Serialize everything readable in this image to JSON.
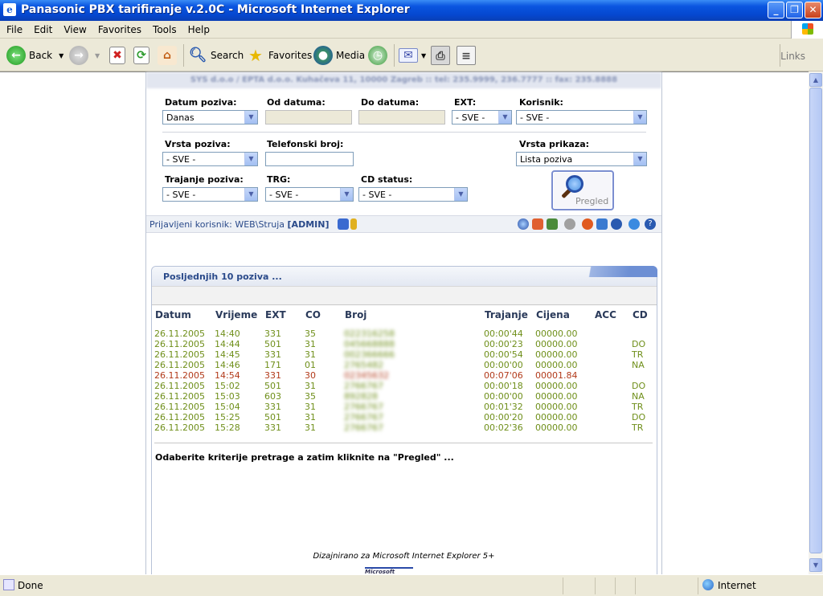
{
  "window": {
    "title": "Panasonic PBX tarifiranje v.2.0C - Microsoft Internet Explorer"
  },
  "menu": [
    "File",
    "Edit",
    "View",
    "Favorites",
    "Tools",
    "Help"
  ],
  "toolbar": {
    "back": "Back",
    "search": "Search",
    "favorites": "Favorites",
    "media": "Media",
    "links": "Links"
  },
  "page": {
    "company": "SYS d.o.o / EPTA d.o.o. Kuhačeva 11, 10000 Zagreb :: tel: 235.9999, 236.7777 :: fax: 235.8888",
    "filters": {
      "datum_poziva_label": "Datum poziva:",
      "datum_poziva_value": "Danas",
      "od_datuma_label": "Od datuma:",
      "do_datuma_label": "Do datuma:",
      "ext_label": "EXT:",
      "ext_value": "- SVE -",
      "korisnik_label": "Korisnik:",
      "korisnik_value": "- SVE -",
      "vrsta_poziva_label": "Vrsta poziva:",
      "vrsta_poziva_value": "- SVE -",
      "telefonski_broj_label": "Telefonski broj:",
      "vrsta_prikaza_label": "Vrsta prikaza:",
      "vrsta_prikaza_value": "Lista poziva",
      "trajanje_poziva_label": "Trajanje poziva:",
      "trajanje_poziva_value": "- SVE -",
      "trg_label": "TRG:",
      "trg_value": "- SVE -",
      "cd_status_label": "CD status:",
      "cd_status_value": "- SVE -",
      "pregled": "Pregled"
    },
    "status": {
      "prefix": "Prijavljeni korisnik: ",
      "user": "WEB\\Struja",
      "role": "[ADMIN]"
    },
    "panel_title": "Posljednjih 10 poziva ...",
    "columns": [
      "Datum",
      "Vrijeme",
      "EXT",
      "CO",
      "Broj",
      "Trajanje",
      "Cijena",
      "ACC",
      "CD"
    ],
    "rows": [
      {
        "datum": "26.11.2005",
        "vrijeme": "14:40",
        "ext": "331",
        "co": "35",
        "broj": "022316258",
        "trajanje": "00:00'44",
        "cijena": "00000.00",
        "acc": "",
        "cd": "",
        "status": "ok"
      },
      {
        "datum": "26.11.2005",
        "vrijeme": "14:44",
        "ext": "501",
        "co": "31",
        "broj": "045668888",
        "trajanje": "00:00'23",
        "cijena": "00000.00",
        "acc": "",
        "cd": "DO",
        "status": "ok"
      },
      {
        "datum": "26.11.2005",
        "vrijeme": "14:45",
        "ext": "331",
        "co": "31",
        "broj": "002366666",
        "trajanje": "00:00'54",
        "cijena": "00000.00",
        "acc": "",
        "cd": "TR",
        "status": "ok"
      },
      {
        "datum": "26.11.2005",
        "vrijeme": "14:46",
        "ext": "171",
        "co": "01",
        "broj": "2765482",
        "trajanje": "00:00'00",
        "cijena": "00000.00",
        "acc": "",
        "cd": "NA",
        "status": "ok"
      },
      {
        "datum": "26.11.2005",
        "vrijeme": "14:54",
        "ext": "331",
        "co": "30",
        "broj": "02345632",
        "trajanje": "00:07'06",
        "cijena": "00001.84",
        "acc": "",
        "cd": "",
        "status": "red"
      },
      {
        "datum": "26.11.2005",
        "vrijeme": "15:02",
        "ext": "501",
        "co": "31",
        "broj": "2766767",
        "trajanje": "00:00'18",
        "cijena": "00000.00",
        "acc": "",
        "cd": "DO",
        "status": "ok"
      },
      {
        "datum": "26.11.2005",
        "vrijeme": "15:03",
        "ext": "603",
        "co": "35",
        "broj": "892828",
        "trajanje": "00:00'00",
        "cijena": "00000.00",
        "acc": "",
        "cd": "NA",
        "status": "ok"
      },
      {
        "datum": "26.11.2005",
        "vrijeme": "15:04",
        "ext": "331",
        "co": "31",
        "broj": "2766767",
        "trajanje": "00:01'32",
        "cijena": "00000.00",
        "acc": "",
        "cd": "TR",
        "status": "ok"
      },
      {
        "datum": "26.11.2005",
        "vrijeme": "15:25",
        "ext": "501",
        "co": "31",
        "broj": "2766767",
        "trajanje": "00:00'20",
        "cijena": "00000.00",
        "acc": "",
        "cd": "DO",
        "status": "ok"
      },
      {
        "datum": "26.11.2005",
        "vrijeme": "15:28",
        "ext": "331",
        "co": "31",
        "broj": "2766767",
        "trajanje": "00:02'36",
        "cijena": "00000.00",
        "acc": "",
        "cd": "TR",
        "status": "ok"
      }
    ],
    "hint": "Odaberite kriterije pretrage a zatim kliknite na \"Pregled\" ...",
    "footer": "Dizajnirano za Microsoft Internet Explorer 5+",
    "ms_logo_text": "Microsoft"
  },
  "statusbar": {
    "left": "Done",
    "zone": "Internet"
  },
  "colors": {
    "ok_row": "#6f8f1a",
    "red_row": "#b23a1a",
    "accent": "#2a4a8a"
  }
}
